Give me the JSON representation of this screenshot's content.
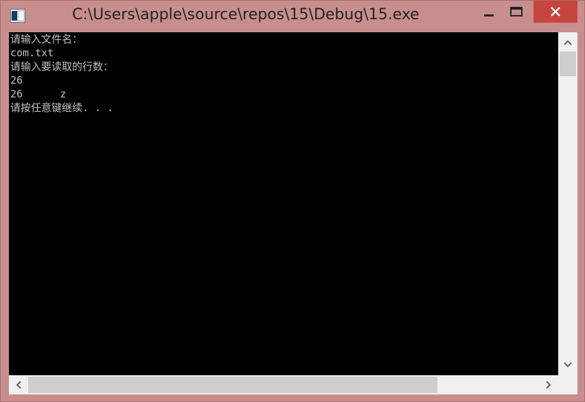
{
  "window": {
    "title": "C:\\Users\\apple\\source\\repos\\15\\Debug\\15.exe",
    "frame_color": "#c88e8e",
    "close_button_color": "#c7453f"
  },
  "controls": {
    "minimize_icon": "minimize-icon",
    "maximize_icon": "maximize-icon",
    "close_icon": "close-icon"
  },
  "console": {
    "background": "#000000",
    "text_color": "#c0c0c0",
    "lines": [
      "请输入文件名：",
      "com.txt",
      "请输入要读取的行数：",
      "26",
      "26      z",
      "请按任意键继续. . ."
    ]
  },
  "scrollbars": {
    "vertical_position": 0.0,
    "horizontal_position": 0.0
  }
}
